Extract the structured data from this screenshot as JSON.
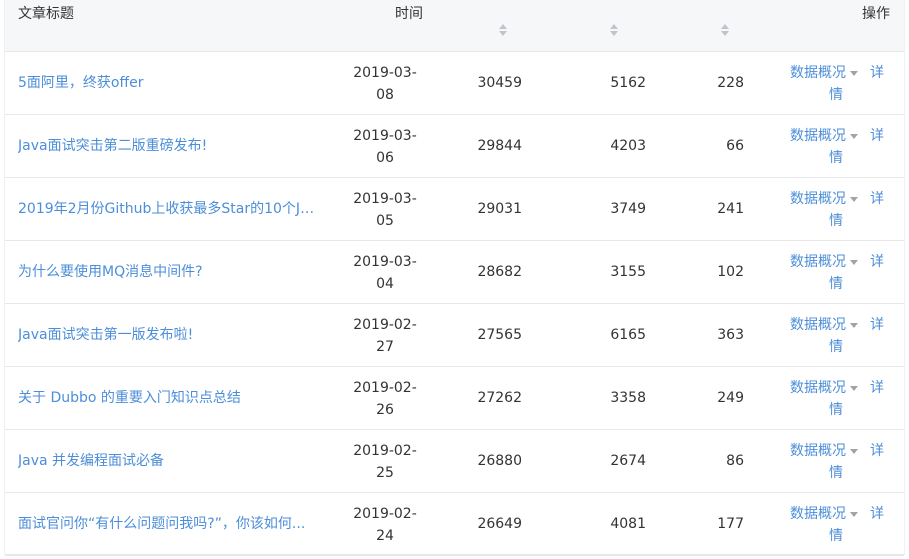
{
  "table": {
    "headers": {
      "title": "文章标题",
      "time": "时间",
      "actions": "操作"
    },
    "rows": [
      {
        "title": "5面阿里，终获offer",
        "date_line1": "2019-03-",
        "date_line2": "08",
        "views": "30459",
        "col2": "5162",
        "col3": "228"
      },
      {
        "title": "Java面试突击第二版重磅发布!",
        "date_line1": "2019-03-",
        "date_line2": "06",
        "views": "29844",
        "col2": "4203",
        "col3": "66"
      },
      {
        "title": "2019年2月份Github上收获最多Star的10个Ja...",
        "date_line1": "2019-03-",
        "date_line2": "05",
        "views": "29031",
        "col2": "3749",
        "col3": "241"
      },
      {
        "title": "为什么要使用MQ消息中间件?",
        "date_line1": "2019-03-",
        "date_line2": "04",
        "views": "28682",
        "col2": "3155",
        "col3": "102"
      },
      {
        "title": "Java面试突击第一版发布啦!",
        "date_line1": "2019-02-",
        "date_line2": "27",
        "views": "27565",
        "col2": "6165",
        "col3": "363"
      },
      {
        "title": "关于 Dubbo 的重要入门知识点总结",
        "date_line1": "2019-02-",
        "date_line2": "26",
        "views": "27262",
        "col2": "3358",
        "col3": "249"
      },
      {
        "title": "Java 并发编程面试必备",
        "date_line1": "2019-02-",
        "date_line2": "25",
        "views": "26880",
        "col2": "2674",
        "col3": "86"
      },
      {
        "title": "面试官问你“有什么问题问我吗?”，你该如何...",
        "date_line1": "2019-02-",
        "date_line2": "24",
        "views": "26649",
        "col2": "4081",
        "col3": "177"
      }
    ],
    "action_menu_label": "数据概况",
    "detail_label_part1": "详",
    "detail_label_part2": "情"
  },
  "colors": {
    "link": "#4c8ed9",
    "header_bg": "#f6f7f9",
    "border": "#e8e8e8"
  }
}
